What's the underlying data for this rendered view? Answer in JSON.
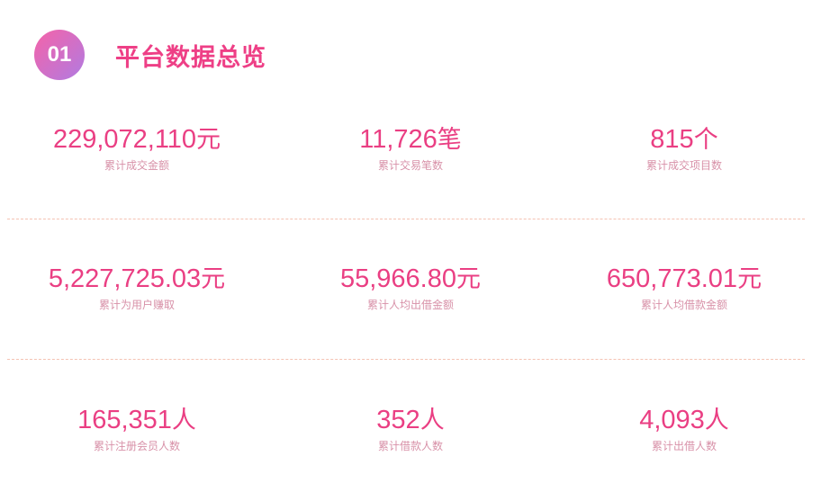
{
  "header": {
    "badge": "01",
    "title": "平台数据总览"
  },
  "rows": [
    [
      {
        "value": "229,072,110",
        "unit": "元",
        "label": "累计成交金额"
      },
      {
        "value": "11,726",
        "unit": "笔",
        "label": "累计交易笔数"
      },
      {
        "value": "815",
        "unit": "个",
        "label": "累计成交项目数"
      }
    ],
    [
      {
        "value": "5,227,725.03",
        "unit": "元",
        "label": "累计为用户赚取"
      },
      {
        "value": "55,966.80",
        "unit": "元",
        "label": "累计人均出借金额"
      },
      {
        "value": "650,773.01",
        "unit": "元",
        "label": "累计人均借款金额"
      }
    ],
    [
      {
        "value": "165,351",
        "unit": "人",
        "label": "累计注册会员人数"
      },
      {
        "value": "352",
        "unit": "人",
        "label": "累计借款人数"
      },
      {
        "value": "4,093",
        "unit": "人",
        "label": "累计出借人数"
      }
    ]
  ]
}
